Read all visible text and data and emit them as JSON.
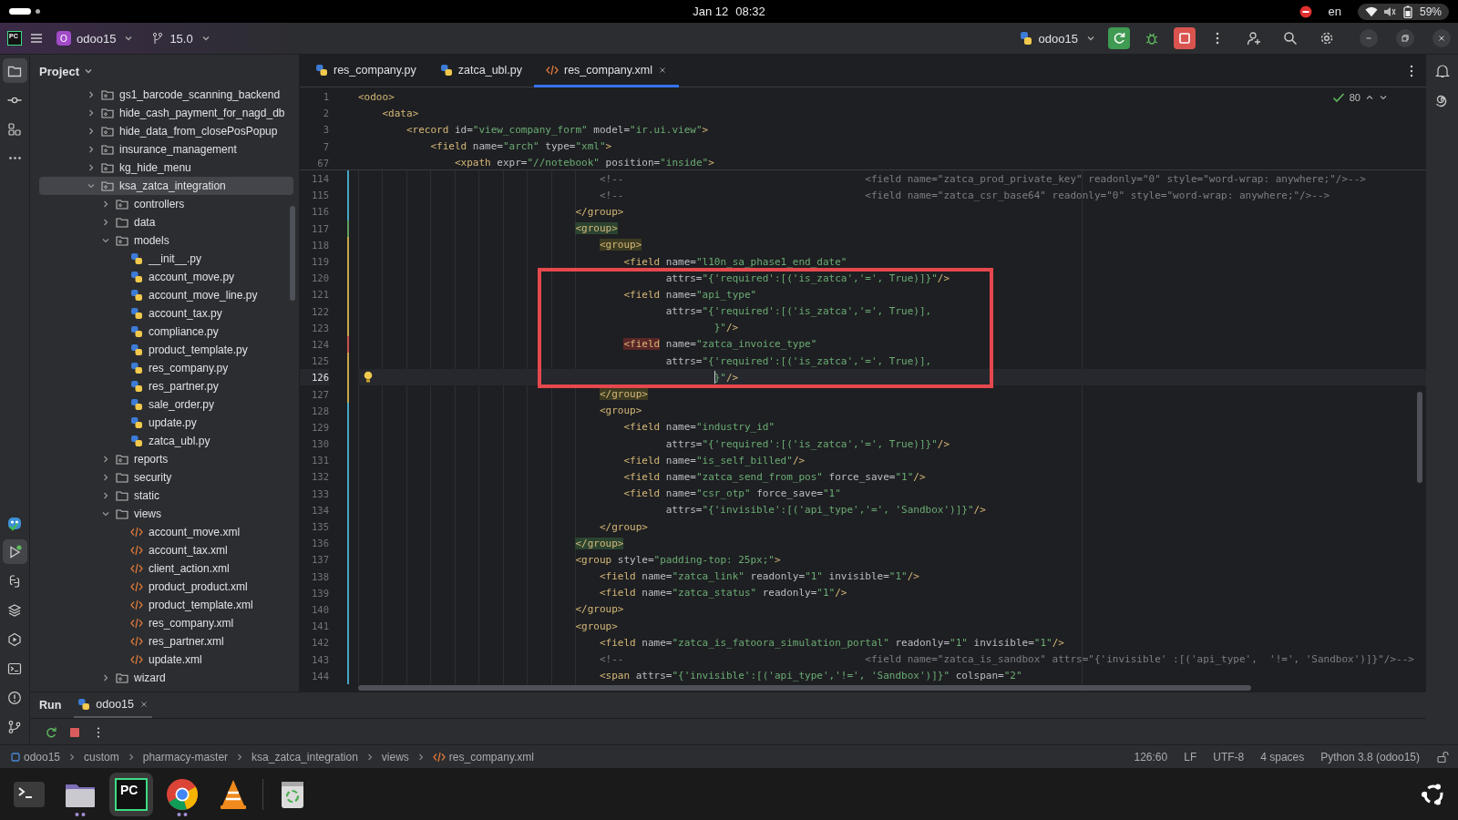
{
  "system_bar": {
    "date": "Jan 12",
    "time": "08:32",
    "language": "en",
    "battery": "59%"
  },
  "title_bar": {
    "logo_text": "PC",
    "project_badge": "O",
    "project": "odoo15",
    "branch": "15.0",
    "run_config": "odoo15"
  },
  "tool_strip": {
    "top": [
      {
        "kind": "project",
        "selected": true
      },
      {
        "kind": "commit",
        "selected": false
      },
      {
        "kind": "structure",
        "selected": false
      },
      {
        "kind": "more",
        "selected": false
      }
    ],
    "bottom": [
      {
        "kind": "bot",
        "selected": false
      },
      {
        "kind": "run",
        "selected": true,
        "running": true
      },
      {
        "kind": "python",
        "selected": false
      },
      {
        "kind": "layers",
        "selected": false
      },
      {
        "kind": "services",
        "selected": false
      },
      {
        "kind": "terminal",
        "selected": false
      },
      {
        "kind": "problems",
        "selected": false
      },
      {
        "kind": "git",
        "selected": false
      }
    ]
  },
  "project_panel": {
    "title": "Project",
    "tree": [
      {
        "label": "gs1_barcode_scanning_backend",
        "kind": "package",
        "expanded": false,
        "selected": false
      },
      {
        "label": "hide_cash_payment_for_nagd_db",
        "kind": "package",
        "expanded": false,
        "selected": false
      },
      {
        "label": "hide_data_from_closePosPopup",
        "kind": "package",
        "expanded": false,
        "selected": false
      },
      {
        "label": "insurance_management",
        "kind": "package",
        "expanded": false,
        "selected": false
      },
      {
        "label": "kg_hide_menu",
        "kind": "package",
        "expanded": false,
        "selected": false
      },
      {
        "label": "ksa_zatca_integration",
        "kind": "package",
        "expanded": true,
        "selected": true,
        "children": [
          {
            "label": "controllers",
            "kind": "package",
            "expanded": false,
            "selected": false
          },
          {
            "label": "data",
            "kind": "folder",
            "expanded": false,
            "selected": false
          },
          {
            "label": "models",
            "kind": "package",
            "expanded": true,
            "selected": false,
            "children": [
              {
                "label": "__init__.py",
                "kind": "py",
                "selected": false
              },
              {
                "label": "account_move.py",
                "kind": "py",
                "selected": false
              },
              {
                "label": "account_move_line.py",
                "kind": "py",
                "selected": false
              },
              {
                "label": "account_tax.py",
                "kind": "py",
                "selected": false
              },
              {
                "label": "compliance.py",
                "kind": "py",
                "selected": false
              },
              {
                "label": "product_template.py",
                "kind": "py",
                "selected": false
              },
              {
                "label": "res_company.py",
                "kind": "py",
                "selected": false
              },
              {
                "label": "res_partner.py",
                "kind": "py",
                "selected": false
              },
              {
                "label": "sale_order.py",
                "kind": "py",
                "selected": false
              },
              {
                "label": "update.py",
                "kind": "py",
                "selected": false
              },
              {
                "label": "zatca_ubl.py",
                "kind": "py",
                "selected": false
              }
            ]
          },
          {
            "label": "reports",
            "kind": "package",
            "expanded": false,
            "selected": false
          },
          {
            "label": "security",
            "kind": "folder",
            "expanded": false,
            "selected": false
          },
          {
            "label": "static",
            "kind": "folder",
            "expanded": false,
            "selected": false
          },
          {
            "label": "views",
            "kind": "folder",
            "expanded": true,
            "selected": false,
            "children": [
              {
                "label": "account_move.xml",
                "kind": "xml",
                "selected": false
              },
              {
                "label": "account_tax.xml",
                "kind": "xml",
                "selected": false
              },
              {
                "label": "client_action.xml",
                "kind": "xml",
                "selected": false
              },
              {
                "label": "product_product.xml",
                "kind": "xml",
                "selected": false
              },
              {
                "label": "product_template.xml",
                "kind": "xml",
                "selected": false
              },
              {
                "label": "res_company.xml",
                "kind": "xml",
                "selected": false
              },
              {
                "label": "res_partner.xml",
                "kind": "xml",
                "selected": false
              },
              {
                "label": "update.xml",
                "kind": "xml",
                "selected": false
              }
            ]
          },
          {
            "label": "wizard",
            "kind": "package",
            "expanded": false,
            "selected": false
          }
        ]
      }
    ]
  },
  "editor": {
    "tabs": [
      {
        "label": "res_company.py",
        "kind": "py",
        "selected": false
      },
      {
        "label": "zatca_ubl.py",
        "kind": "py",
        "selected": false
      },
      {
        "label": "res_company.xml",
        "kind": "xml",
        "selected": true
      }
    ],
    "inspection_count": "80",
    "sticky_lines": [
      {
        "no": "1",
        "text": "<odoo>"
      },
      {
        "no": "2",
        "text": "    <data>"
      },
      {
        "no": "3",
        "text": "        <record id=\"view_company_form\" model=\"ir.ui.view\">"
      },
      {
        "no": "7",
        "text": "            <field name=\"arch\" type=\"xml\">"
      },
      {
        "no": "67",
        "text": "                <xpath expr=\"//notebook\" position=\"inside\">"
      }
    ],
    "lines": [
      {
        "no": "114",
        "text": "                                        <!--                                        <field name=\"zatca_prod_private_key\" readonly=\"0\" style=\"word-wrap: anywhere;\"/>-->",
        "current": false,
        "color": "#4aa5c5"
      },
      {
        "no": "115",
        "text": "                                        <!--                                        <field name=\"zatca_csr_base64\" readonly=\"0\" style=\"word-wrap: anywhere;\"/>-->",
        "current": false,
        "color": "#4aa5c5"
      },
      {
        "no": "116",
        "text": "                                    </group>",
        "current": false,
        "color": "#4aa5c5"
      },
      {
        "no": "117",
        "text": "                                    <group>",
        "current": false,
        "color": "#5f9e5e",
        "matched": true
      },
      {
        "no": "118",
        "text": "                                        <group>",
        "current": false,
        "color": "#c7a74a",
        "scope": true
      },
      {
        "no": "119",
        "text": "                                            <field name=\"l10n_sa_phase1_end_date\"",
        "current": false,
        "color": "#c7a74a"
      },
      {
        "no": "120",
        "text": "                                                   attrs=\"{'required':[('is_zatca','=', True)]}\"/>",
        "current": false,
        "color": "#c7a74a"
      },
      {
        "no": "121",
        "text": "                                            <field name=\"api_type\"",
        "current": false,
        "color": "#c7a74a"
      },
      {
        "no": "122",
        "text": "                                                   attrs=\"{'required':[('is_zatca','=', True)],",
        "current": false,
        "color": "#c7a74a"
      },
      {
        "no": "123",
        "text": "                                                           }\"/>",
        "current": false,
        "color": "#c7a74a"
      },
      {
        "no": "124",
        "text": "                                            <field name=\"zatca_invoice_type\"",
        "current": false,
        "color": "#c94f4f",
        "error": true
      },
      {
        "no": "125",
        "text": "                                                   attrs=\"{'required':[('is_zatca','=', True)],",
        "current": false,
        "color": "#c7a74a"
      },
      {
        "no": "126",
        "text": "                                                           }\"/>",
        "current": true,
        "color": "#c7a74a"
      },
      {
        "no": "127",
        "text": "                                        </group>",
        "current": false,
        "color": "#c7a74a",
        "scope": true
      },
      {
        "no": "128",
        "text": "                                        <group>",
        "current": false,
        "color": "#4aa5c5"
      },
      {
        "no": "129",
        "text": "                                            <field name=\"industry_id\"",
        "current": false,
        "color": "#4aa5c5"
      },
      {
        "no": "130",
        "text": "                                                   attrs=\"{'required':[('is_zatca','=', True)]}\"/>",
        "current": false,
        "color": "#4aa5c5"
      },
      {
        "no": "131",
        "text": "                                            <field name=\"is_self_billed\"/>",
        "current": false,
        "color": "#4aa5c5"
      },
      {
        "no": "132",
        "text": "                                            <field name=\"zatca_send_from_pos\" force_save=\"1\"/>",
        "current": false,
        "color": "#4aa5c5"
      },
      {
        "no": "133",
        "text": "                                            <field name=\"csr_otp\" force_save=\"1\"",
        "current": false,
        "color": "#4aa5c5"
      },
      {
        "no": "134",
        "text": "                                                   attrs=\"{'invisible':[('api_type','=', 'Sandbox')]}\"/>",
        "current": false,
        "color": "#4aa5c5"
      },
      {
        "no": "135",
        "text": "                                        </group>",
        "current": false,
        "color": "#4aa5c5"
      },
      {
        "no": "136",
        "text": "                                    </group>",
        "current": false,
        "color": "#4aa5c5",
        "matched": true
      },
      {
        "no": "137",
        "text": "                                    <group style=\"padding-top: 25px;\">",
        "current": false,
        "color": "#4aa5c5"
      },
      {
        "no": "138",
        "text": "                                        <field name=\"zatca_link\" readonly=\"1\" invisible=\"1\"/>",
        "current": false,
        "color": "#4aa5c5"
      },
      {
        "no": "139",
        "text": "                                        <field name=\"zatca_status\" readonly=\"1\"/>",
        "current": false,
        "color": "#4aa5c5"
      },
      {
        "no": "140",
        "text": "                                    </group>",
        "current": false,
        "color": "#4aa5c5"
      },
      {
        "no": "141",
        "text": "                                    <group>",
        "current": false,
        "color": "#4aa5c5"
      },
      {
        "no": "142",
        "text": "                                        <field name=\"zatca_is_fatoora_simulation_portal\" readonly=\"1\" invisible=\"1\"/>",
        "current": false,
        "color": "#4aa5c5"
      },
      {
        "no": "143",
        "text": "                                        <!--                                        <field name=\"zatca_is_sandbox\" attrs=\"{'invisible' :[('api_type',  '!=', 'Sandbox')]}\"/>-->",
        "current": false,
        "color": "#4aa5c5"
      },
      {
        "no": "144",
        "text": "                                        <span attrs=\"{'invisible':[('api_type','!=', 'Sandbox')]}\" colspan=\"2\"",
        "current": false,
        "color": "#4aa5c5"
      }
    ]
  },
  "run_panel": {
    "title": "Run",
    "tabs": [
      {
        "label": "odoo15",
        "selected": true
      }
    ]
  },
  "status_bar": {
    "breadcrumbs": [
      {
        "label": "odoo15",
        "kind": "project"
      },
      {
        "label": "custom",
        "kind": "folder"
      },
      {
        "label": "pharmacy-master",
        "kind": "folder"
      },
      {
        "label": "ksa_zatca_integration",
        "kind": "folder"
      },
      {
        "label": "views",
        "kind": "folder"
      },
      {
        "label": "res_company.xml",
        "kind": "xml"
      }
    ],
    "position": "126:60",
    "line_separator": "LF",
    "encoding": "UTF-8",
    "indent": "4 spaces",
    "interpreter": "Python 3.8 (odoo15)"
  },
  "dock": {
    "apps": [
      {
        "kind": "terminal",
        "running": false,
        "selected": false
      },
      {
        "kind": "files",
        "running": true,
        "selected": false
      },
      {
        "kind": "pycharm",
        "running": false,
        "selected": true,
        "logo_text": "PC"
      },
      {
        "kind": "chrome",
        "running": true,
        "selected": false
      },
      {
        "kind": "vlc",
        "running": false,
        "selected": false
      },
      {
        "kind": "trash",
        "running": false,
        "selected": false
      }
    ]
  }
}
